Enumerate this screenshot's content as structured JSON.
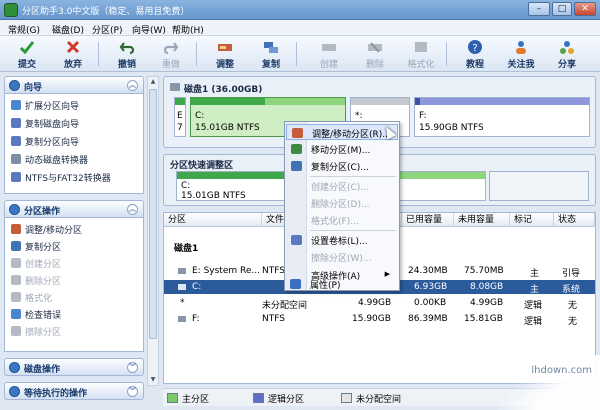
{
  "window": {
    "title": "分区助手3.0中文版（稳定、易用且免费）",
    "buttons": [
      "–",
      "□",
      "✕"
    ]
  },
  "menubar": [
    "常规(G)",
    "磁盘(D)",
    "分区(P)",
    "向导(W)",
    "帮助(H)"
  ],
  "toolbar": [
    {
      "label": "提交",
      "icon": "check-icon",
      "enabled": true
    },
    {
      "label": "放弃",
      "icon": "x-icon",
      "enabled": true
    },
    {
      "label": "撤销",
      "icon": "undo-icon",
      "enabled": true
    },
    {
      "label": "重做",
      "icon": "redo-icon",
      "enabled": false
    },
    {
      "label": "调整",
      "icon": "resize-icon",
      "enabled": true
    },
    {
      "label": "复制",
      "icon": "copy-icon",
      "enabled": true
    },
    {
      "label": "创建",
      "icon": "create-icon",
      "enabled": false
    },
    {
      "label": "删除",
      "icon": "delete-icon",
      "enabled": false
    },
    {
      "label": "格式化",
      "icon": "format-icon",
      "enabled": false
    },
    {
      "label": "教程",
      "icon": "help-icon",
      "enabled": true
    },
    {
      "label": "关注我",
      "icon": "follow-icon",
      "enabled": true
    },
    {
      "label": "分享",
      "icon": "share-icon",
      "enabled": true
    }
  ],
  "sidebar": {
    "wizard": {
      "title": "向导",
      "items": [
        {
          "label": "扩展分区向导",
          "enabled": true
        },
        {
          "label": "复制磁盘向导",
          "enabled": true
        },
        {
          "label": "复制分区向导",
          "enabled": true
        },
        {
          "label": "动态磁盘转换器",
          "enabled": true
        },
        {
          "label": "NTFS与FAT32转换器",
          "enabled": true
        }
      ]
    },
    "partition_ops": {
      "title": "分区操作",
      "items": [
        {
          "label": "调整/移动分区",
          "enabled": true
        },
        {
          "label": "复制分区",
          "enabled": true
        },
        {
          "label": "创建分区",
          "enabled": false
        },
        {
          "label": "删除分区",
          "enabled": false
        },
        {
          "label": "格式化",
          "enabled": false
        },
        {
          "label": "检查错误",
          "enabled": true
        },
        {
          "label": "擦除分区",
          "enabled": false
        }
      ]
    },
    "disk_ops": {
      "title": "磁盘操作"
    },
    "pending_ops": {
      "title": "等待执行的操作"
    }
  },
  "disk_map": {
    "title": "磁盘1 (36.00GB)",
    "partitions": [
      {
        "name": "E",
        "size": "7",
        "color": "#3fa84a",
        "fill": 0.8
      },
      {
        "name": "C:",
        "size": "15.01GB NTFS",
        "color": "#3fa84a",
        "fill": 0.48,
        "selected": true
      },
      {
        "name": "*:",
        "size": "5.",
        "color": "#c6c9cf",
        "fill": 0.0
      },
      {
        "name": "F:",
        "size": "15.90GB NTFS",
        "color": "#5f6fc7",
        "fill": 0.05
      }
    ]
  },
  "quick": {
    "title": "分区快速调整区",
    "name": "C:",
    "size": "15.01GB NTFS",
    "fill": 0.48
  },
  "table": {
    "headers": [
      "分区",
      "文件",
      "",
      "",
      "已用容量",
      "未用容量",
      "标记",
      "状态"
    ],
    "disk_label": "磁盘1",
    "rows": [
      {
        "partition": "E:  System Re...",
        "fs": "NTFS",
        "capacity": "",
        "used": "24.30MB",
        "unused": "75.70MB",
        "flag": "主",
        "status": "引导",
        "selected": false
      },
      {
        "partition": "C:",
        "fs": "",
        "capacity": "",
        "used": "6.93GB",
        "unused": "8.08GB",
        "flag": "主",
        "status": "系统",
        "selected": true
      },
      {
        "partition": "*",
        "fs": "未分配空间",
        "capacity": "4.99GB",
        "used": "0.00KB",
        "unused": "4.99GB",
        "flag": "逻辑",
        "status": "无",
        "selected": false
      },
      {
        "partition": "F:",
        "fs": "NTFS",
        "capacity": "15.90GB",
        "used": "86.39MB",
        "unused": "15.81GB",
        "flag": "逻辑",
        "status": "无",
        "selected": false
      }
    ]
  },
  "legend": [
    {
      "label": "主分区",
      "color": "#7cc96a"
    },
    {
      "label": "逻辑分区",
      "color": "#5f6fc7"
    },
    {
      "label": "未分配空间",
      "color": "#e4e4e4"
    }
  ],
  "context_menu": [
    {
      "label": "调整/移动分区(R)...",
      "enabled": true,
      "highlight": true,
      "icon": "resize-icon"
    },
    {
      "label": "移动分区(M)...",
      "enabled": true,
      "icon": "move-icon"
    },
    {
      "label": "复制分区(C)...",
      "enabled": true,
      "icon": "copy-icon"
    },
    {
      "label": "创建分区(C)...",
      "enabled": false
    },
    {
      "label": "删除分区(D)...",
      "enabled": false
    },
    {
      "label": "格式化(F)...",
      "enabled": false
    },
    {
      "label": "设置卷标(L)...",
      "enabled": true,
      "icon": "label-icon"
    },
    {
      "label": "擦除分区(W)...",
      "enabled": false
    },
    {
      "label": "高级操作(A)",
      "enabled": true,
      "submenu": true
    },
    {
      "label": "属性(P)",
      "enabled": true,
      "icon": "properties-icon"
    }
  ],
  "watermark": "lhdown.com",
  "colors": {
    "accent": "#2c5b9c",
    "primary": "#3fa84a",
    "logical": "#5f6fc7"
  }
}
